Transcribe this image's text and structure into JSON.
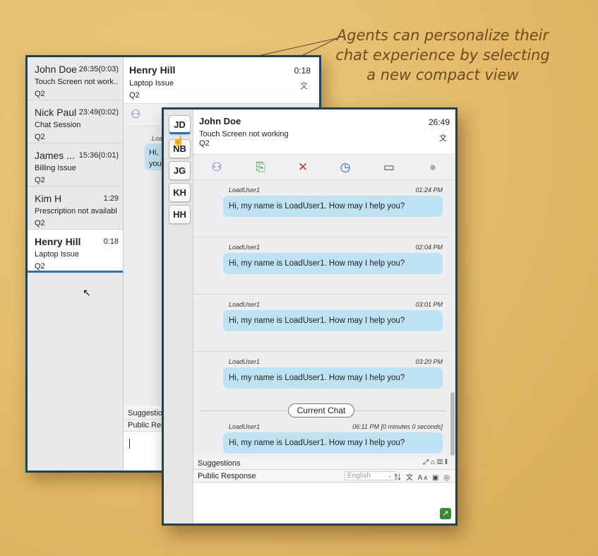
{
  "caption": {
    "line1": "Agents can personalize their",
    "line2": "chat experience by selecting",
    "line3": "a new compact view"
  },
  "back_window": {
    "list": [
      {
        "name": "John Doe",
        "time": "26:35(0:03)",
        "issue": "Touch Screen not work...",
        "queue": "Q2"
      },
      {
        "name": "Nick Paul",
        "time": "23:49(0:02)",
        "issue": "Chat Session",
        "queue": "Q2"
      },
      {
        "name": "James ...",
        "time": "15:36(0:01)",
        "issue": "Billing Issue",
        "queue": "Q2"
      },
      {
        "name": "Kim H",
        "time": "1:29",
        "issue": "Prescription not available",
        "queue": "Q2"
      },
      {
        "name": "Henry Hill",
        "time": "0:18",
        "issue": "Laptop Issue",
        "queue": "Q2"
      }
    ],
    "chat": {
      "name": "Henry Hill",
      "time": "0:18",
      "issue": "Laptop Issue",
      "queue": "Q2",
      "sender_partial": "Loa",
      "bubble_partial": "Hi, you",
      "suggestions_label": "Suggestion",
      "public_label": "Public Resp"
    }
  },
  "front_window": {
    "tabs": [
      "JD",
      "NB",
      "JG",
      "KH",
      "HH"
    ],
    "header": {
      "name": "John Doe",
      "time": "26:49",
      "issue": "Touch Screen not working",
      "queue": "Q2"
    },
    "messages": [
      {
        "sender": "LoadUser1",
        "time": "01:24 PM",
        "text": "Hi, my name is LoadUser1. How may I help you?"
      },
      {
        "sender": "LoadUser1",
        "time": "02:04 PM",
        "text": "Hi, my name is LoadUser1. How may I help you?"
      },
      {
        "sender": "LoadUser1",
        "time": "03:01 PM",
        "text": "Hi, my name is LoadUser1. How may I help you?"
      },
      {
        "sender": "LoadUser1",
        "time": "03:20 PM",
        "text": "Hi, my name is LoadUser1. How may I help you?"
      }
    ],
    "current_chat_label": "Current Chat",
    "current_message": {
      "sender": "LoadUser1",
      "time": "06:11 PM [0 minutes 0 seconds]",
      "text": "Hi, my name is LoadUser1. How may I help you?"
    },
    "suggestions_label": "Suggestions",
    "public_response_label": "Public Response",
    "language_selected": "English"
  },
  "colors": {
    "background": "#e4bd6e",
    "window_border": "#244150",
    "caption": "#6e4a22",
    "bubble": "#bfe2f2",
    "active_underline": "#2f6fb4",
    "icon_purple": "#7b5bb3",
    "icon_green": "#3e9c4a",
    "icon_red": "#c0392b",
    "icon_blue": "#2b5fa6"
  }
}
